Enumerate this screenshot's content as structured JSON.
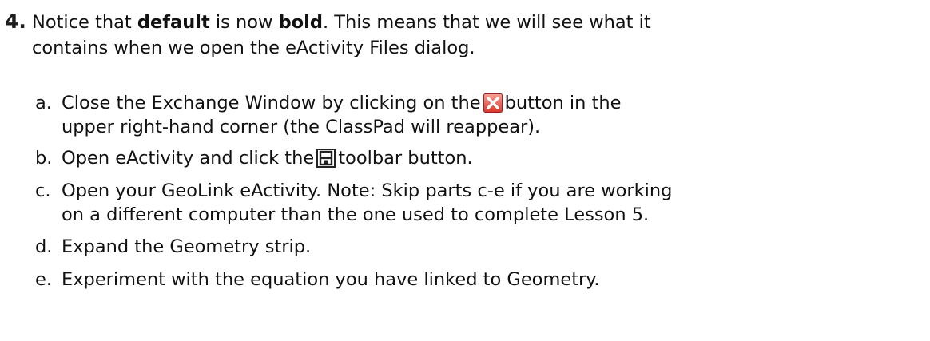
{
  "step": {
    "number": "4.",
    "line1": {
      "t1": "Notice that ",
      "b1": "default",
      "t2": " is now ",
      "b2": "bold",
      "t3": ". This means that we will see what it"
    },
    "line2": "contains when we open the eActivity Files dialog."
  },
  "substeps": [
    {
      "letter": "a.",
      "l1_before": "Close the Exchange Window by clicking on the",
      "icon": "close-x-icon",
      "l1_after": "button in the",
      "l2": "upper right-hand corner (the ClassPad will reappear)."
    },
    {
      "letter": "b.",
      "l1_before": "Open eActivity and click the",
      "icon": "save-floppy-icon",
      "l1_after": "toolbar button."
    },
    {
      "letter": "c.",
      "l1": "Open your GeoLink eActivity. Note: Skip parts c-e if you are working",
      "l2": "on a different computer than the one used to complete Lesson 5."
    },
    {
      "letter": "d.",
      "l1": "Expand the Geometry strip."
    },
    {
      "letter": "e.",
      "l1": "Experiment with the equation you have linked to Geometry."
    }
  ],
  "colors": {
    "close_icon_red": "#e8554a",
    "close_icon_border": "#a02020",
    "save_icon_stroke": "#222222"
  }
}
